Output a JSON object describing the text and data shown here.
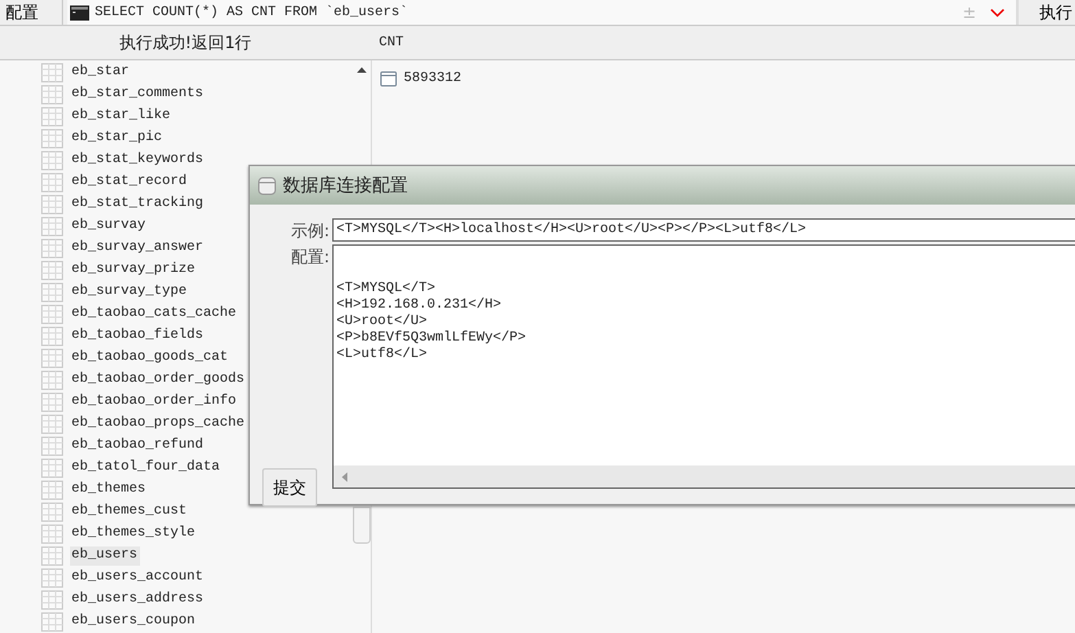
{
  "toolbar": {
    "config_button": "配置",
    "query": "SELECT COUNT(*) AS CNT FROM `eb_users`",
    "plus_minus": "±",
    "run_button": "执行"
  },
  "result_header": {
    "status": "执行成功!返回1行",
    "column": "CNT"
  },
  "tables": [
    {
      "name": "eb_star",
      "selected": false
    },
    {
      "name": "eb_star_comments",
      "selected": false
    },
    {
      "name": "eb_star_like",
      "selected": false
    },
    {
      "name": "eb_star_pic",
      "selected": false
    },
    {
      "name": "eb_stat_keywords",
      "selected": false
    },
    {
      "name": "eb_stat_record",
      "selected": false
    },
    {
      "name": "eb_stat_tracking",
      "selected": false
    },
    {
      "name": "eb_survay",
      "selected": false
    },
    {
      "name": "eb_survay_answer",
      "selected": false
    },
    {
      "name": "eb_survay_prize",
      "selected": false
    },
    {
      "name": "eb_survay_type",
      "selected": false
    },
    {
      "name": "eb_taobao_cats_cache",
      "selected": false
    },
    {
      "name": "eb_taobao_fields",
      "selected": false
    },
    {
      "name": "eb_taobao_goods_cat",
      "selected": false
    },
    {
      "name": "eb_taobao_order_goods",
      "selected": false
    },
    {
      "name": "eb_taobao_order_info",
      "selected": false
    },
    {
      "name": "eb_taobao_props_cache",
      "selected": false
    },
    {
      "name": "eb_taobao_refund",
      "selected": false
    },
    {
      "name": "eb_tatol_four_data",
      "selected": false
    },
    {
      "name": "eb_themes",
      "selected": false
    },
    {
      "name": "eb_themes_cust",
      "selected": false
    },
    {
      "name": "eb_themes_style",
      "selected": false
    },
    {
      "name": "eb_users",
      "selected": true
    },
    {
      "name": "eb_users_account",
      "selected": false
    },
    {
      "name": "eb_users_address",
      "selected": false
    },
    {
      "name": "eb_users_coupon",
      "selected": false
    }
  ],
  "result_rows": [
    "5893312"
  ],
  "dialog": {
    "title": "数据库连接配置",
    "example_label": "示例:",
    "example": "<T>MYSQL</T><H>localhost</H><U>root</U><P></P><L>utf8</L>",
    "config_label": "配置:",
    "config": "\n\n<T>MYSQL</T>\n<H>192.168.0.231</H>\n<U>root</U>\n<P>b8EVf5Q3wmlLfEWy</P>\n<L>utf8</L>",
    "submit_button": "提交"
  }
}
